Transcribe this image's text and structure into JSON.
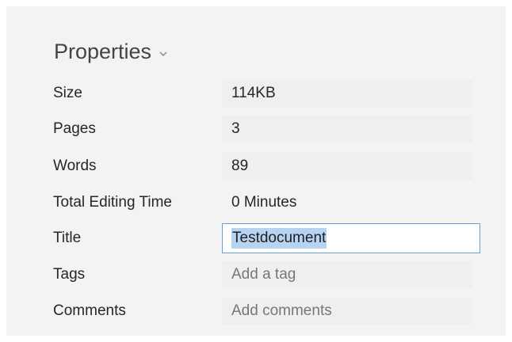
{
  "section": {
    "title": "Properties",
    "chevron_icon": "chevron-down-icon"
  },
  "properties": {
    "size": {
      "label": "Size",
      "value": "114KB"
    },
    "pages": {
      "label": "Pages",
      "value": "3"
    },
    "words": {
      "label": "Words",
      "value": "89"
    },
    "editing_time": {
      "label": "Total Editing Time",
      "value": "0 Minutes"
    },
    "title": {
      "label": "Title",
      "value": "Testdocument"
    },
    "tags": {
      "label": "Tags",
      "placeholder": "Add a tag"
    },
    "comments": {
      "label": "Comments",
      "placeholder": "Add comments"
    }
  },
  "colors": {
    "panel_background": "#f3f3f3",
    "focus_border": "#6a9ed8",
    "text_selection": "#b6d4f1"
  }
}
